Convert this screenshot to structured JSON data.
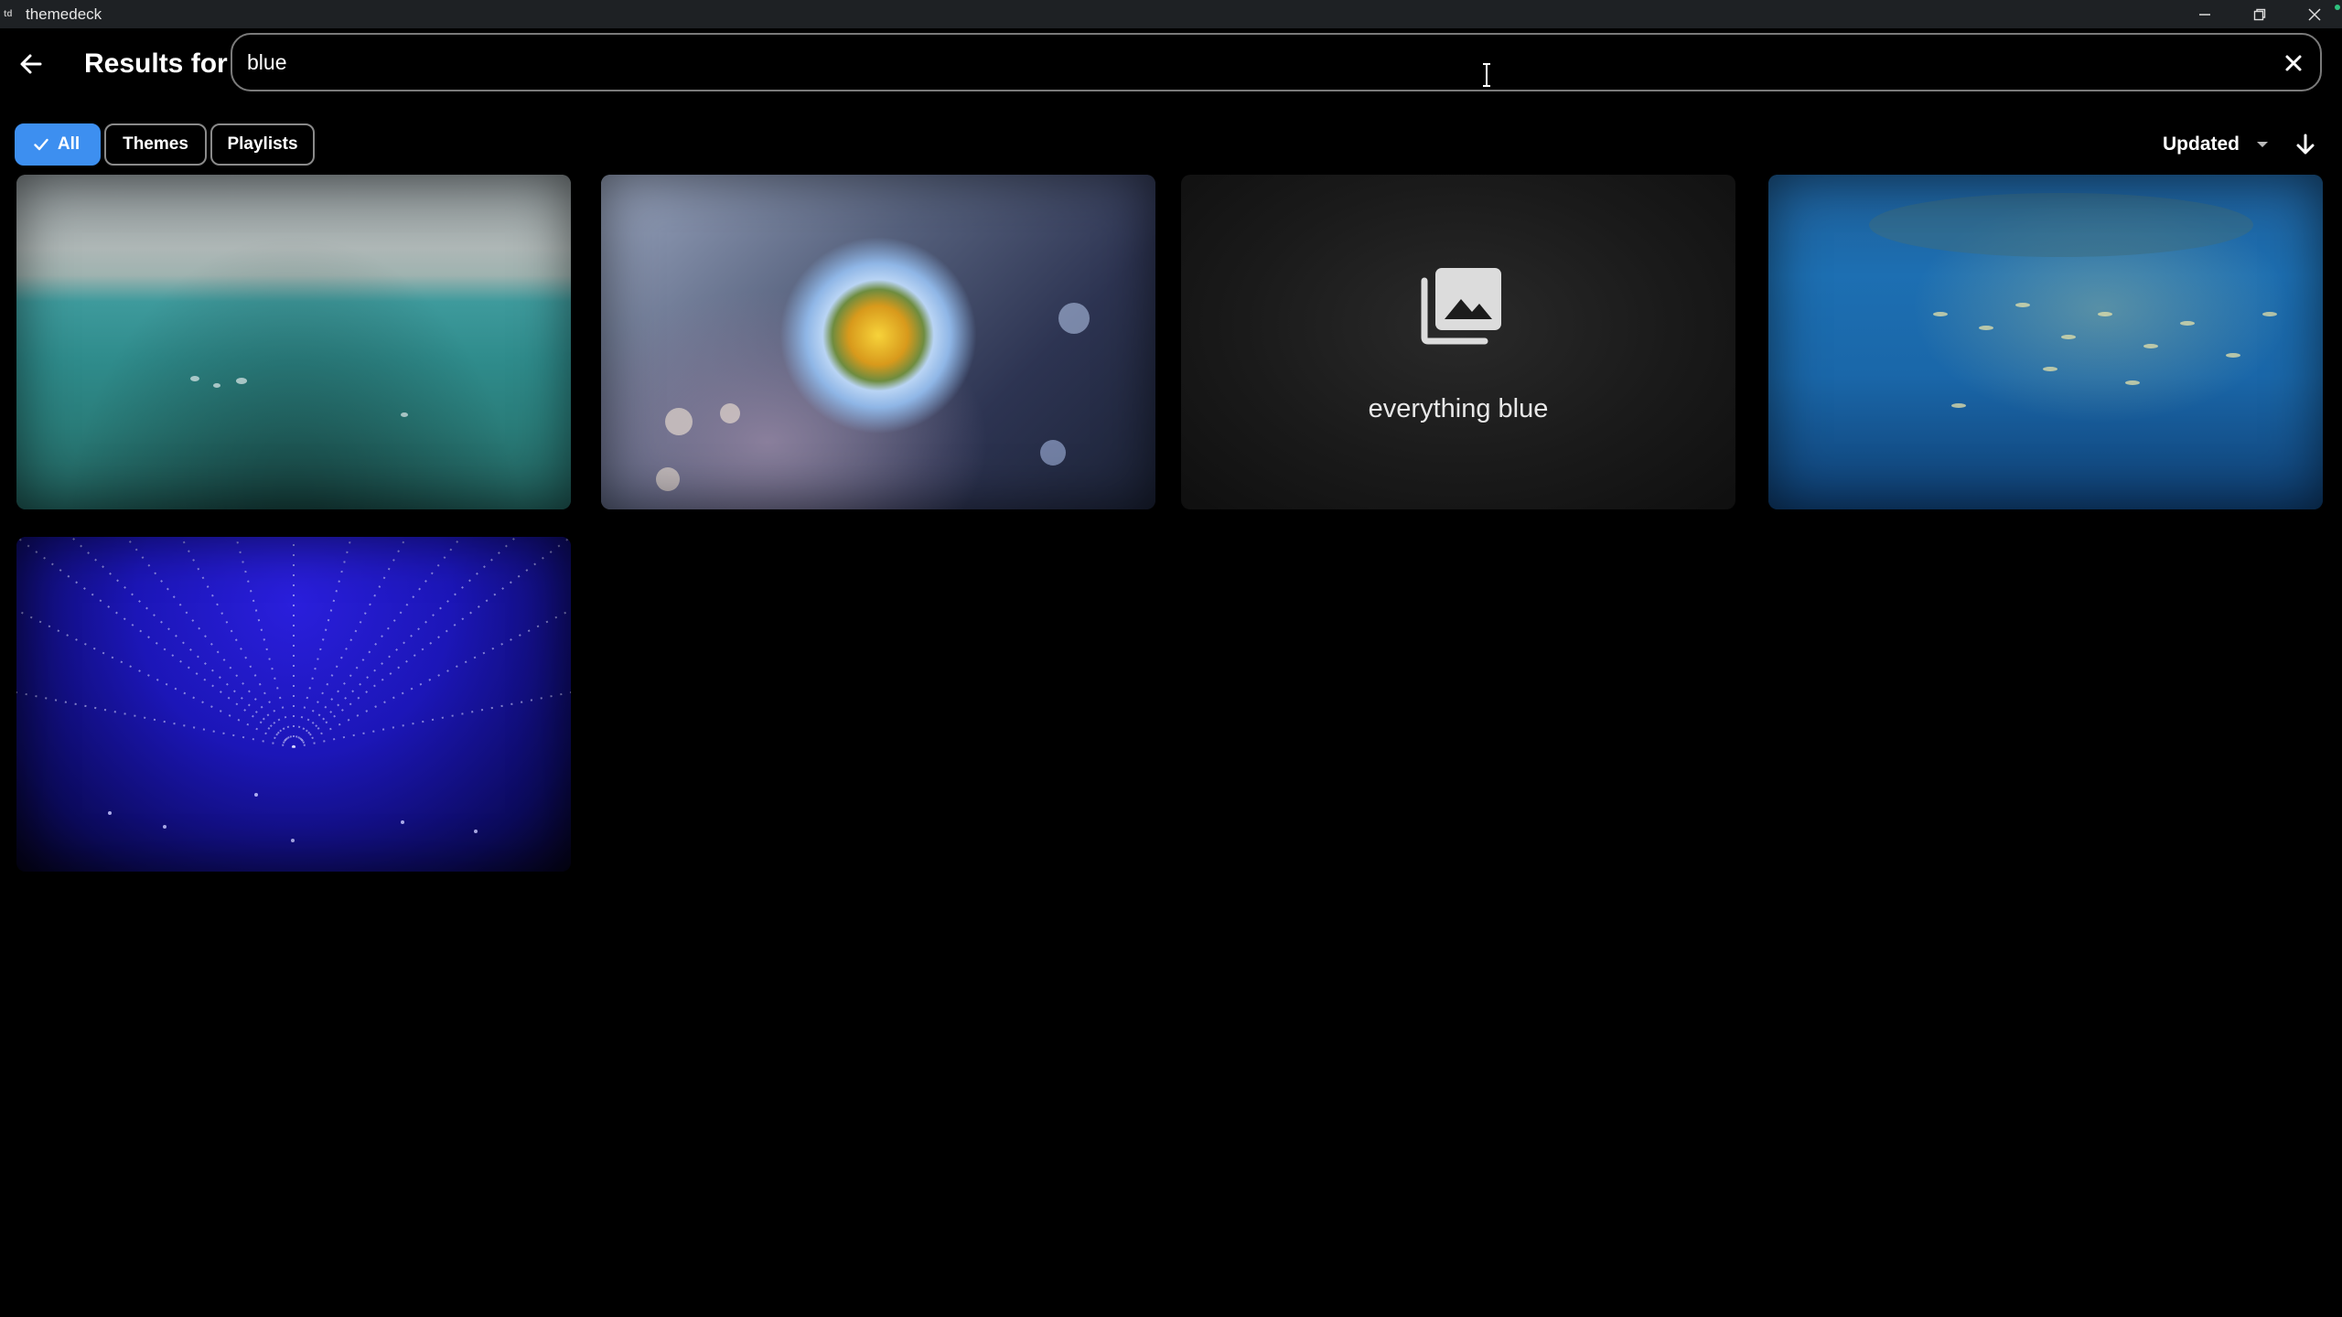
{
  "window": {
    "logo": "td",
    "title": "themedeck"
  },
  "header": {
    "results_label": "Results for",
    "search_value": "blue",
    "search_placeholder": ""
  },
  "filters": [
    {
      "label": "All",
      "active": true
    },
    {
      "label": "Themes",
      "active": false
    },
    {
      "label": "Playlists",
      "active": false
    }
  ],
  "sort": {
    "label": "Updated",
    "direction": "descending"
  },
  "tiles": [
    {
      "kind": "theme",
      "image": "ocean-waves"
    },
    {
      "kind": "theme",
      "image": "anime-eye"
    },
    {
      "kind": "playlist",
      "label": "everything blue",
      "icon": "image-stack-icon"
    },
    {
      "kind": "theme",
      "image": "underwater-shark-fish"
    },
    {
      "kind": "theme",
      "image": "blue-light-tunnel"
    }
  ],
  "colors": {
    "accent": "#3d8ff0",
    "titlebar": "#1e2124",
    "background": "#000000"
  }
}
